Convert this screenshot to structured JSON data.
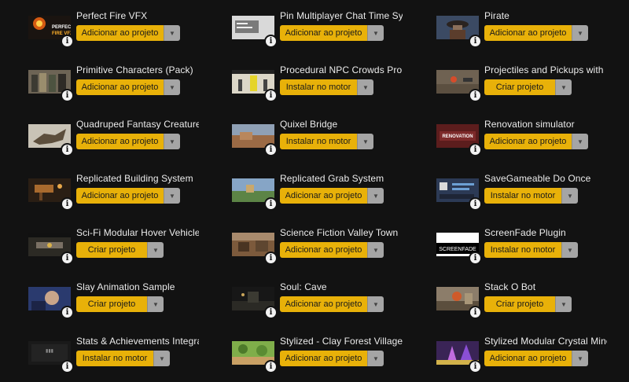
{
  "actions": {
    "add": "Adicionar ao projeto",
    "install": "Instalar no motor",
    "create": "Criar projeto"
  },
  "info_glyph": "i",
  "arrow_glyph": "▼",
  "items": [
    {
      "title": "Perfect Fire VFX",
      "action": "add",
      "thumb": "fire"
    },
    {
      "title": "Pin Multiplayer Chat Time Sys",
      "action": "add",
      "thumb": "chat"
    },
    {
      "title": "Pirate",
      "action": "add",
      "thumb": "pirate"
    },
    {
      "title": "Primitive Characters (Pack)",
      "action": "add",
      "thumb": "characters"
    },
    {
      "title": "Procedural NPC Crowds Pro V",
      "action": "install",
      "thumb": "crowds"
    },
    {
      "title": "Projectiles and Pickups with I",
      "action": "create",
      "thumb": "projectiles"
    },
    {
      "title": "Quadruped Fantasy Creature",
      "action": "add",
      "thumb": "creature"
    },
    {
      "title": "Quixel Bridge",
      "action": "install",
      "thumb": "bridge"
    },
    {
      "title": "Renovation simulator",
      "action": "add",
      "thumb": "renovation"
    },
    {
      "title": "Replicated Building System",
      "action": "add",
      "thumb": "building"
    },
    {
      "title": "Replicated Grab System",
      "action": "add",
      "thumb": "grab"
    },
    {
      "title": "SaveGameable Do Once",
      "action": "install",
      "thumb": "savegame"
    },
    {
      "title": "Sci-Fi Modular Hover Vehicle",
      "action": "create",
      "thumb": "hover"
    },
    {
      "title": "Science Fiction Valley Town",
      "action": "add",
      "thumb": "valley"
    },
    {
      "title": "ScreenFade Plugin",
      "action": "install",
      "thumb": "screenfade"
    },
    {
      "title": "Slay Animation Sample",
      "action": "create",
      "thumb": "slay"
    },
    {
      "title": "Soul: Cave",
      "action": "add",
      "thumb": "cave"
    },
    {
      "title": "Stack O Bot",
      "action": "create",
      "thumb": "stackobot"
    },
    {
      "title": "Stats & Achievements Integra",
      "action": "install",
      "thumb": "stats"
    },
    {
      "title": "Stylized - Clay Forest Village",
      "action": "add",
      "thumb": "clay"
    },
    {
      "title": "Stylized Modular Crystal Mine",
      "action": "add",
      "thumb": "crystal"
    }
  ],
  "thumb_text": {
    "fire": "PERFECT FIRE VFX",
    "renovation": "RENOVATION",
    "screenfade": "SCREENFADE"
  },
  "colors": {
    "accent": "#e8b109",
    "arrow_bg": "#a5a5a5",
    "background": "#121212"
  }
}
